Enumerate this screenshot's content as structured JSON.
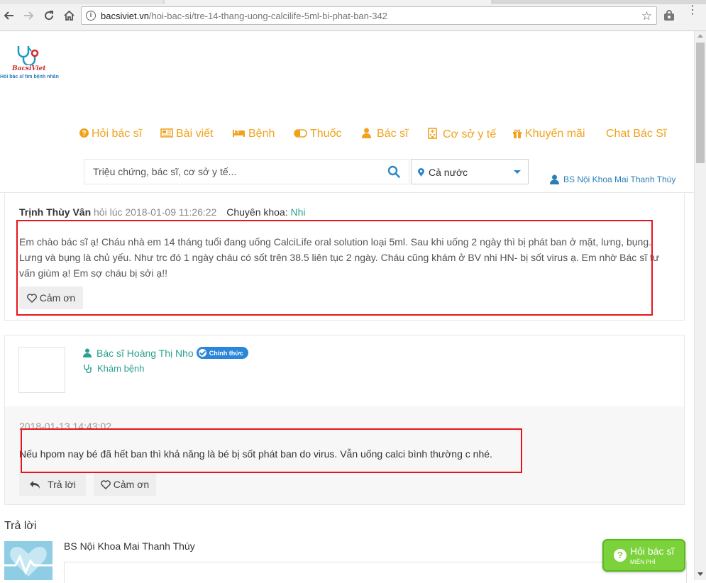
{
  "browser": {
    "url_host": "bacsiviet.vn",
    "url_path": "/hoi-bac-si/tre-14-thang-uong-calcilife-5ml-bi-phat-ban-342"
  },
  "logo": {
    "brand": "BacsiViet",
    "tagline": "Hỏi bác sĩ tìm bệnh nhân"
  },
  "nav": {
    "items": [
      {
        "label": "Hỏi bác sĩ",
        "icon": "question-circle-icon"
      },
      {
        "label": "Bài viết",
        "icon": "newspaper-icon"
      },
      {
        "label": "Bệnh",
        "icon": "bed-icon"
      },
      {
        "label": "Thuốc",
        "icon": "pill-icon"
      },
      {
        "label": "Bác sĩ",
        "icon": "doctor-icon"
      },
      {
        "label": "Cơ sở y tế",
        "icon": "hospital-icon"
      },
      {
        "label": "Khuyến mãi",
        "icon": "gift-icon"
      },
      {
        "label": "Chat Bác Sĩ",
        "icon": ""
      }
    ]
  },
  "search": {
    "placeholder": "Triệu chứng, bác sĩ, cơ sở y tế..."
  },
  "region": {
    "selected": "Cả nước"
  },
  "user": {
    "name": "BS Nội Khoa Mai Thanh Thúy"
  },
  "question": {
    "author": "Trịnh Thùy Vân",
    "asked_at": "hỏi lúc 2018-01-09 11:26:22",
    "specialty_label": "Chuyên khoa:",
    "specialty": "Nhi",
    "text": "Em chào bác sĩ ạ! Cháu nhà em 14 tháng tuổi đang uống CalciLife oral solution loại 5ml. Sau khi uống 2 ngày thì bị phát ban ở mặt, lưng, bụng. Lưng và bụng là chủ yếu. Như trc đó 1 ngày cháu có sốt trên 38.5 liên tục 2 ngày. Cháu cũng khám ở BV nhi HN- bị sốt virus ạ. Em nhờ Bác sĩ tư vấn giùm ạ! Em sợ cháu bị sởi ạ!!",
    "thanks_label": "Cảm ơn"
  },
  "answer": {
    "doctor_name": "Bác sĩ Hoàng Thị Nho",
    "badge": "Chính thức",
    "service": "Khám bệnh",
    "time": "2018-01-13 14:43:02",
    "text": "Nếu hpom nay bé đã hết ban thì khả năng là bé bị sốt phát ban do virus. Vẫn uống calci bình thường c nhé.",
    "reply_label": "Trả lời",
    "thanks_label": "Cảm ơn"
  },
  "reply_section": {
    "title": "Trả lời",
    "user": "BS Nội Khoa Mai Thanh Thúy"
  },
  "floating_cta": {
    "label": "Hỏi bác sĩ",
    "sublabel": "MIỄN PHÍ"
  },
  "colors": {
    "nav_orange": "#f0a21d",
    "teal": "#2aa08f",
    "blue": "#2a86d8",
    "highlight_red": "#e8141b",
    "cta_green": "#7bd23b"
  }
}
